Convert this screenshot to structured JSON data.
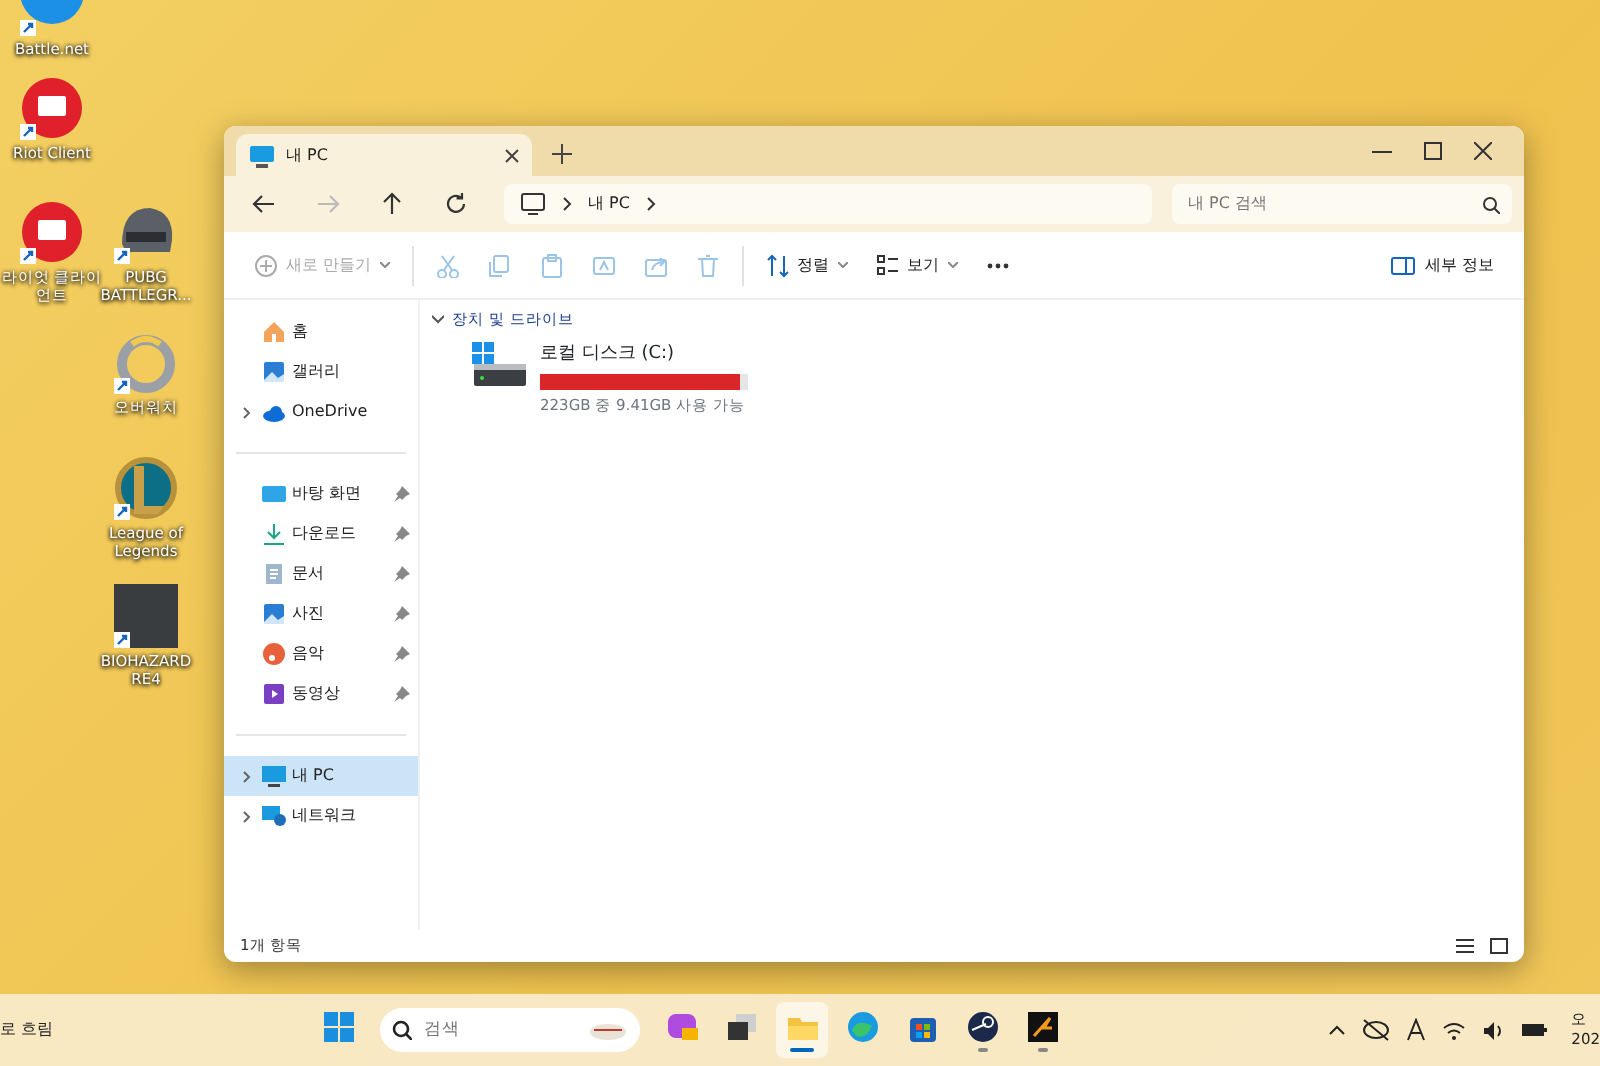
{
  "desktop": {
    "icons": [
      {
        "label": "Battle.net",
        "kind": "battlenet"
      },
      {
        "label": "Riot Client",
        "kind": "riot"
      },
      {
        "label": "라이엇 클라이언트",
        "kind": "riot"
      },
      {
        "label": "PUBG BATTLEGR...",
        "kind": "pubg"
      },
      {
        "label": "오버워치",
        "kind": "overwatch"
      },
      {
        "label": "League of Legends",
        "kind": "lol"
      },
      {
        "label": "BIOHAZARD RE4",
        "kind": "re4"
      }
    ]
  },
  "explorer": {
    "tabs": [
      {
        "label": "내 PC",
        "selected": true
      }
    ],
    "breadcrumb": [
      "내 PC"
    ],
    "search": {
      "placeholder": "내 PC 검색"
    },
    "nav_buttons": [
      {
        "kind": "back",
        "disabled": false
      },
      {
        "kind": "forward",
        "disabled": true
      },
      {
        "kind": "up",
        "disabled": false
      },
      {
        "kind": "refresh",
        "disabled": false
      }
    ],
    "toolbar": {
      "groups": [
        [
          {
            "kind": "new",
            "label": "새로 만들기",
            "disabled": true,
            "dropdown": true
          }
        ],
        [
          {
            "kind": "cut",
            "disabled": true
          },
          {
            "kind": "copy",
            "disabled": true
          },
          {
            "kind": "paste",
            "disabled": true
          },
          {
            "kind": "rename",
            "disabled": true
          },
          {
            "kind": "share",
            "disabled": true
          },
          {
            "kind": "delete",
            "disabled": true
          }
        ],
        [
          {
            "kind": "sort",
            "label": "정렬",
            "disabled": false,
            "dropdown": true
          },
          {
            "kind": "view",
            "label": "보기",
            "disabled": false,
            "dropdown": true
          },
          {
            "kind": "more",
            "disabled": false
          }
        ]
      ],
      "details": {
        "label": "세부 정보"
      }
    },
    "sidebar": {
      "groups": [
        [
          {
            "label": "홈",
            "kind": "home",
            "pinned": false,
            "expandable": false,
            "selected": false
          },
          {
            "label": "갤러리",
            "kind": "gallery",
            "pinned": false,
            "expandable": false,
            "selected": false
          },
          {
            "label": "OneDrive",
            "kind": "cloud",
            "pinned": false,
            "expandable": true,
            "selected": false
          }
        ],
        [
          {
            "label": "바탕 화면",
            "kind": "desktop",
            "pinned": true,
            "expandable": false,
            "selected": false
          },
          {
            "label": "다운로드",
            "kind": "download",
            "pinned": true,
            "expandable": false,
            "selected": false
          },
          {
            "label": "문서",
            "kind": "document",
            "pinned": true,
            "expandable": false,
            "selected": false
          },
          {
            "label": "사진",
            "kind": "gallery",
            "pinned": true,
            "expandable": false,
            "selected": false
          },
          {
            "label": "음악",
            "kind": "music",
            "pinned": true,
            "expandable": false,
            "selected": false
          },
          {
            "label": "동영상",
            "kind": "video",
            "pinned": true,
            "expandable": false,
            "selected": false
          }
        ],
        [
          {
            "label": "내 PC",
            "kind": "pc",
            "pinned": false,
            "expandable": true,
            "selected": true
          },
          {
            "label": "네트워크",
            "kind": "network",
            "pinned": false,
            "expandable": true,
            "selected": false
          }
        ]
      ]
    },
    "section": {
      "title": "장치 및 드라이브",
      "expanded": true,
      "drives": [
        {
          "name": "로컬 디스크 (C:)",
          "level": 0.958,
          "free": "223GB 중 9.41GB 사용 가능"
        }
      ]
    },
    "status_bar": {
      "count": "1개 항목"
    }
  },
  "taskbar": {
    "weather": "로 흐림",
    "search": {
      "placeholder": "검색"
    },
    "apps": [
      {
        "kind": "start",
        "running": false,
        "active": false
      },
      {
        "kind": "copilot",
        "running": false,
        "active": false
      },
      {
        "kind": "taskview",
        "running": false,
        "active": false
      },
      {
        "kind": "explorer",
        "running": true,
        "active": true
      },
      {
        "kind": "edge",
        "running": false,
        "active": false
      },
      {
        "kind": "store",
        "running": false,
        "active": false
      },
      {
        "kind": "steam",
        "running": true,
        "active": false
      },
      {
        "kind": "game",
        "running": true,
        "active": false
      }
    ],
    "clock": {
      "time": "오",
      "date": "202"
    }
  }
}
